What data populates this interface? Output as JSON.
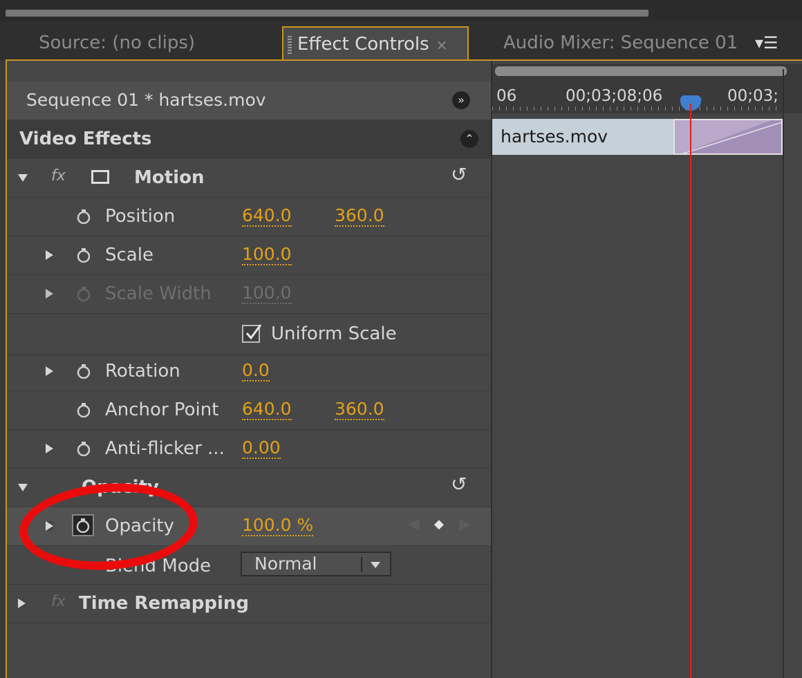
{
  "tabs": {
    "source": "Source: (no clips)",
    "effect_controls": "Effect Controls",
    "audio_mixer": "Audio Mixer: Sequence 01"
  },
  "header": {
    "sequence_clip": "Sequence 01 * hartses.mov"
  },
  "sections": {
    "video_effects": "Video Effects",
    "motion": "Motion",
    "opacity_group": "Opacity",
    "time_remapping": "Time Remapping"
  },
  "motion": {
    "position": {
      "label": "Position",
      "x": "640.0",
      "y": "360.0"
    },
    "scale": {
      "label": "Scale",
      "value": "100.0"
    },
    "scale_width": {
      "label": "Scale Width",
      "value": "100.0"
    },
    "uniform_scale": {
      "label": "Uniform Scale",
      "checked": true
    },
    "rotation": {
      "label": "Rotation",
      "value": "0.0"
    },
    "anchor_point": {
      "label": "Anchor Point",
      "x": "640.0",
      "y": "360.0"
    },
    "anti_flicker": {
      "label": "Anti-flicker ...",
      "value": "0.00"
    }
  },
  "opacity": {
    "opacity": {
      "label": "Opacity",
      "value": "100.0 %"
    },
    "blend_mode": {
      "label": "Blend Mode",
      "value": "Normal"
    }
  },
  "timeline": {
    "time_left": "06",
    "time_mid": "00;03;08;06",
    "time_right": "00;03;",
    "clip_name": "hartses.mov"
  },
  "colors": {
    "accent": "#e3a117",
    "panel_border": "#c9961e",
    "playhead": "#e02020",
    "annotation": "#ea0c0c"
  }
}
